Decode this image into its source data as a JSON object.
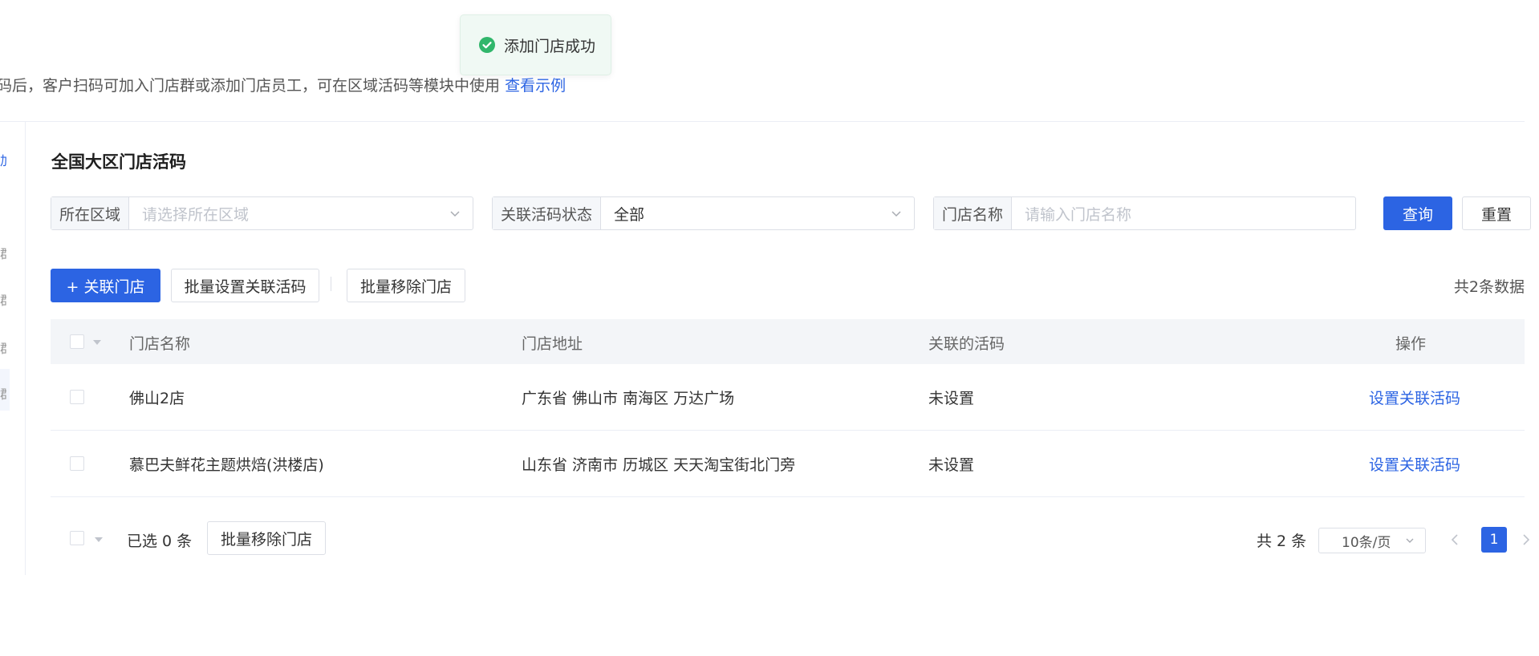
{
  "toast": {
    "text": "添加门店成功",
    "icon": "check-circle-icon",
    "color": "#30b66b"
  },
  "description": {
    "text": "码后，客户扫码可加入门店群或添加门店员工，可在区域活码等模块中使用",
    "link": "查看示例"
  },
  "sidebar": {
    "partial_items": [
      "加",
      "群",
      "群",
      "群",
      "群"
    ]
  },
  "section": {
    "title": "全国大区门店活码"
  },
  "filters": {
    "region": {
      "label": "所在区域",
      "placeholder": "请选择所在区域"
    },
    "status": {
      "label": "关联活码状态",
      "value": "全部"
    },
    "store": {
      "label": "门店名称",
      "placeholder": "请输入门店名称"
    },
    "query_label": "查询",
    "reset_label": "重置"
  },
  "toolbar": {
    "add_label": "+ 关联门店",
    "batch_set_label": "批量设置关联活码",
    "batch_remove_label": "批量移除门店",
    "total_text": "共2条数据"
  },
  "table": {
    "headers": {
      "name": "门店名称",
      "address": "门店地址",
      "code": "关联的活码",
      "action": "操作"
    },
    "rows": [
      {
        "name": "佛山2店",
        "address": "广东省 佛山市 南海区 万达广场",
        "code": "未设置",
        "action": "设置关联活码"
      },
      {
        "name": "慕巴夫鲜花主题烘焙(洪楼店)",
        "address": "山东省 济南市 历城区 天天淘宝街北门旁",
        "code": "未设置",
        "action": "设置关联活码"
      }
    ]
  },
  "footer": {
    "selected_text": "已选 0 条",
    "batch_remove_label": "批量移除门店",
    "total": "共 2 条",
    "page_size": "10条/页",
    "current_page": "1"
  },
  "colors": {
    "primary": "#2c64e3",
    "success": "#30b66b"
  }
}
